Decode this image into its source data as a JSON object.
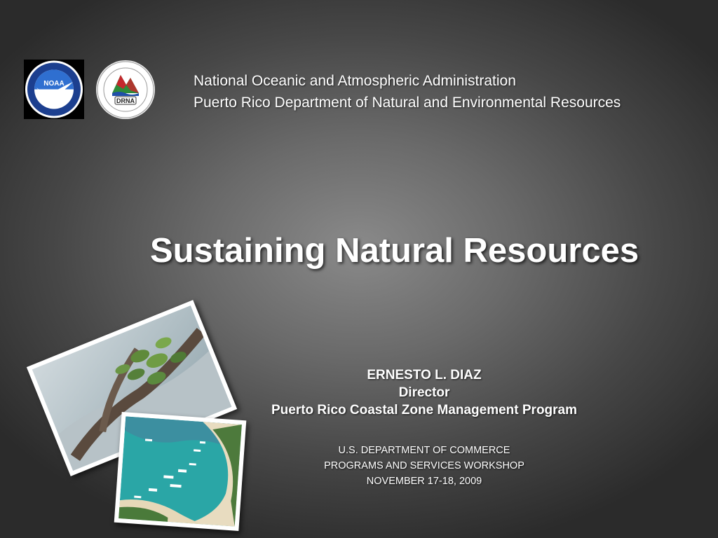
{
  "logos": {
    "noaa_text": "NOAA",
    "drna_text": "DRNA"
  },
  "header": {
    "line1": "National Oceanic and Atmospheric Administration",
    "line2": "Puerto Rico Department of Natural and Environmental Resources"
  },
  "title": "Sustaining Natural Resources",
  "presenter": {
    "name": "ERNESTO L. DIAZ",
    "role": "Director",
    "organization": "Puerto Rico Coastal Zone Management Program"
  },
  "event": {
    "line1": "U.S. DEPARTMENT OF COMMERCE",
    "line2": "PROGRAMS AND SERVICES WORKSHOP",
    "line3": "NOVEMBER 17-18, 2009"
  },
  "colors": {
    "noaa_blue": "#1f4fa8",
    "drna_red": "#c4282d",
    "drna_green": "#2e8b3a",
    "sea_teal": "#2aa6a6"
  }
}
